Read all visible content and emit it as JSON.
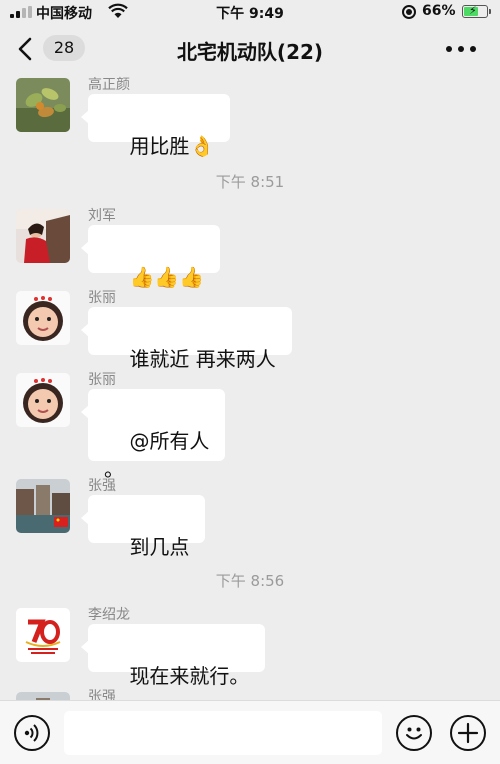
{
  "status_bar": {
    "carrier": "中国移动",
    "time": "下午 9:49",
    "battery_percent": "66%",
    "battery_level": 0.66,
    "signal_icon": "cellular-signal-icon",
    "wifi_icon": "wifi-icon",
    "lock_icon": "orientation-lock-icon",
    "battery_icon": "battery-charging-icon"
  },
  "nav": {
    "back_icon": "chevron-left-icon",
    "unread_count": "28",
    "title": "北宅机动队(22)",
    "more_icon": "more-dots-icon"
  },
  "messages": [
    {
      "sender": "高正颜",
      "text": "用比胜",
      "emoji": "👌"
    },
    {
      "divider": "下午 8:51"
    },
    {
      "sender": "刘军",
      "text": "",
      "emoji": "👍👍👍"
    },
    {
      "sender": "张丽",
      "text": "谁就近 再来两人"
    },
    {
      "sender": "张丽",
      "text": "@所有人\n。"
    },
    {
      "sender": "张强",
      "text": "到几点"
    },
    {
      "divider": "下午 8:56"
    },
    {
      "sender": "李绍龙",
      "text": "现在来就行。"
    },
    {
      "sender": "张强"
    }
  ],
  "input_bar": {
    "voice_icon": "voice-icon",
    "emoji_icon": "emoji-icon",
    "plus_icon": "plus-icon"
  },
  "colors": {
    "background": "#ededed",
    "bubble": "#ffffff",
    "battery": "#4cd964",
    "meta_text": "#888888"
  }
}
